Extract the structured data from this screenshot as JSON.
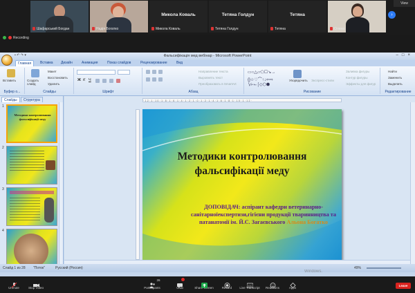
{
  "gallery": {
    "view_label": "View",
    "participants": [
      {
        "name": "Шафарський Богдан",
        "mic_muted": true
      },
      {
        "name": "Надія Богатко",
        "mic_muted": true
      },
      {
        "name": "Микола Коваль",
        "mic_muted": true,
        "display": "Микола Коваль"
      },
      {
        "name": "Тетяна Голдун",
        "mic_muted": true,
        "display": "Тетяна Голдун"
      },
      {
        "name": "Тетяна",
        "mic_muted": true,
        "display": "Тетяна"
      },
      {
        "name": "Олена",
        "mic_muted": true
      }
    ],
    "recording_label": "Recording"
  },
  "ppt": {
    "window_title": "Фальсифікація мед вебінар - Microsoft PowerPoint",
    "tabs": [
      "Главная",
      "Вставка",
      "Дизайн",
      "Анимация",
      "Показ слайдов",
      "Рецензирование",
      "Вид"
    ],
    "ribbon": {
      "clipboard": {
        "paste": "Вставить",
        "cut": "Вырезать",
        "copy": "Копировать",
        "format": "Формат по образцу",
        "label": "Буфер о..."
      },
      "slides": {
        "new_slide": "Создать слайд",
        "layout": "Макет",
        "reset": "Восстановить",
        "delete": "Удалить",
        "label": "Слайды"
      },
      "font": {
        "label": "Шрифт"
      },
      "paragraph": {
        "direction": "Направление текста",
        "align": "Выровнять текст",
        "smartart": "Преобразовать в SmartArt",
        "label": "Абзац"
      },
      "drawing": {
        "arrange": "Упорядочить",
        "quick_styles": "Экспресс-стили",
        "fill": "Заливка фигуры",
        "outline": "Контур фигуры",
        "effects": "Эффекты для фигур",
        "label": "Рисование"
      },
      "editing": {
        "find": "Найти",
        "replace": "Заменить",
        "select": "Выделить",
        "label": "Редактирование"
      }
    },
    "panel_tabs": [
      "Слайды",
      "Структура"
    ],
    "thumbnails": [
      {
        "no": "1",
        "title": "Методики контролювання фальсифікації меду"
      },
      {
        "no": "2",
        "title": "Зміст"
      },
      {
        "no": "3",
        "title": "Основні методи"
      },
      {
        "no": "4",
        "title": "Мікроскопія"
      }
    ],
    "slide": {
      "title_line1": "Методики контролювання",
      "title_line2": "фальсифікації меду",
      "subtitle_main": "ДОПОВІДАЧ: аспірант кафедри ветеринарно-санітарноїекспертизи,гігієни продукції тваринництва та патанатомії  ім. Й.С. Загаєвського  ",
      "subtitle_author": "Альона Богатко"
    },
    "ruler_text": "·12·1·10·1·8·1·6·1·4·1·2·1·0·1·2·1·4·1·6·1·8·1·10·1·12·",
    "status": {
      "slide_of": "Слайд 1 из 28",
      "theme": "\"Поток\"",
      "language": "Русский (Россия)",
      "zoom": "49%"
    },
    "windows_mark": "Windows."
  },
  "toolbar": {
    "buttons": [
      {
        "label": "Unmute",
        "icon": "mic-muted-icon"
      },
      {
        "label": "Stop Video",
        "icon": "camera-icon"
      },
      {
        "label": "Participants",
        "icon": "participants-icon",
        "count": "26"
      },
      {
        "label": "Chat",
        "icon": "chat-icon"
      },
      {
        "label": "Share Screen",
        "icon": "share-screen-icon"
      },
      {
        "label": "Record",
        "icon": "record-icon"
      },
      {
        "label": "Live Transcript",
        "icon": "cc-icon"
      },
      {
        "label": "Reactions",
        "icon": "reactions-icon"
      },
      {
        "label": "Apps",
        "icon": "apps-icon"
      }
    ],
    "leave_label": "Leave",
    "colors": {
      "leave": "#d9231f",
      "share": "#1ea94b",
      "chat_badge": "#e02828"
    }
  }
}
